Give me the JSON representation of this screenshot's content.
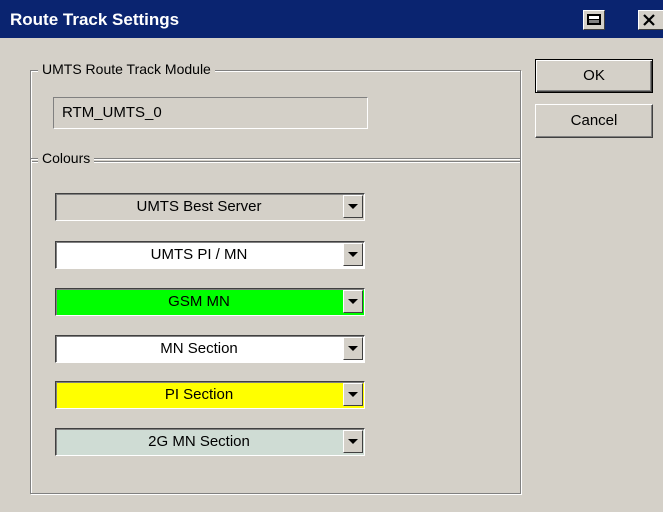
{
  "window": {
    "title": "Route Track Settings"
  },
  "module_group": {
    "legend": "UMTS Route Track Module",
    "value": "RTM_UMTS_0"
  },
  "colours_group": {
    "legend": "Colours",
    "items": [
      {
        "label": "UMTS Best Server",
        "bg": "#d4d0c8"
      },
      {
        "label": "UMTS PI / MN",
        "bg": "#ffffff"
      },
      {
        "label": "GSM MN",
        "bg": "#00ff00"
      },
      {
        "label": "MN Section",
        "bg": "#ffffff"
      },
      {
        "label": "PI Section",
        "bg": "#ffff00"
      },
      {
        "label": "2G MN Section",
        "bg": "#cfdcd4"
      }
    ]
  },
  "buttons": {
    "ok": "OK",
    "cancel": "Cancel"
  },
  "colors": {
    "titlebar": "#0a2470",
    "dialog_face": "#d4d0c8"
  },
  "icons": {
    "help": "help-book-icon",
    "close": "close-icon"
  }
}
